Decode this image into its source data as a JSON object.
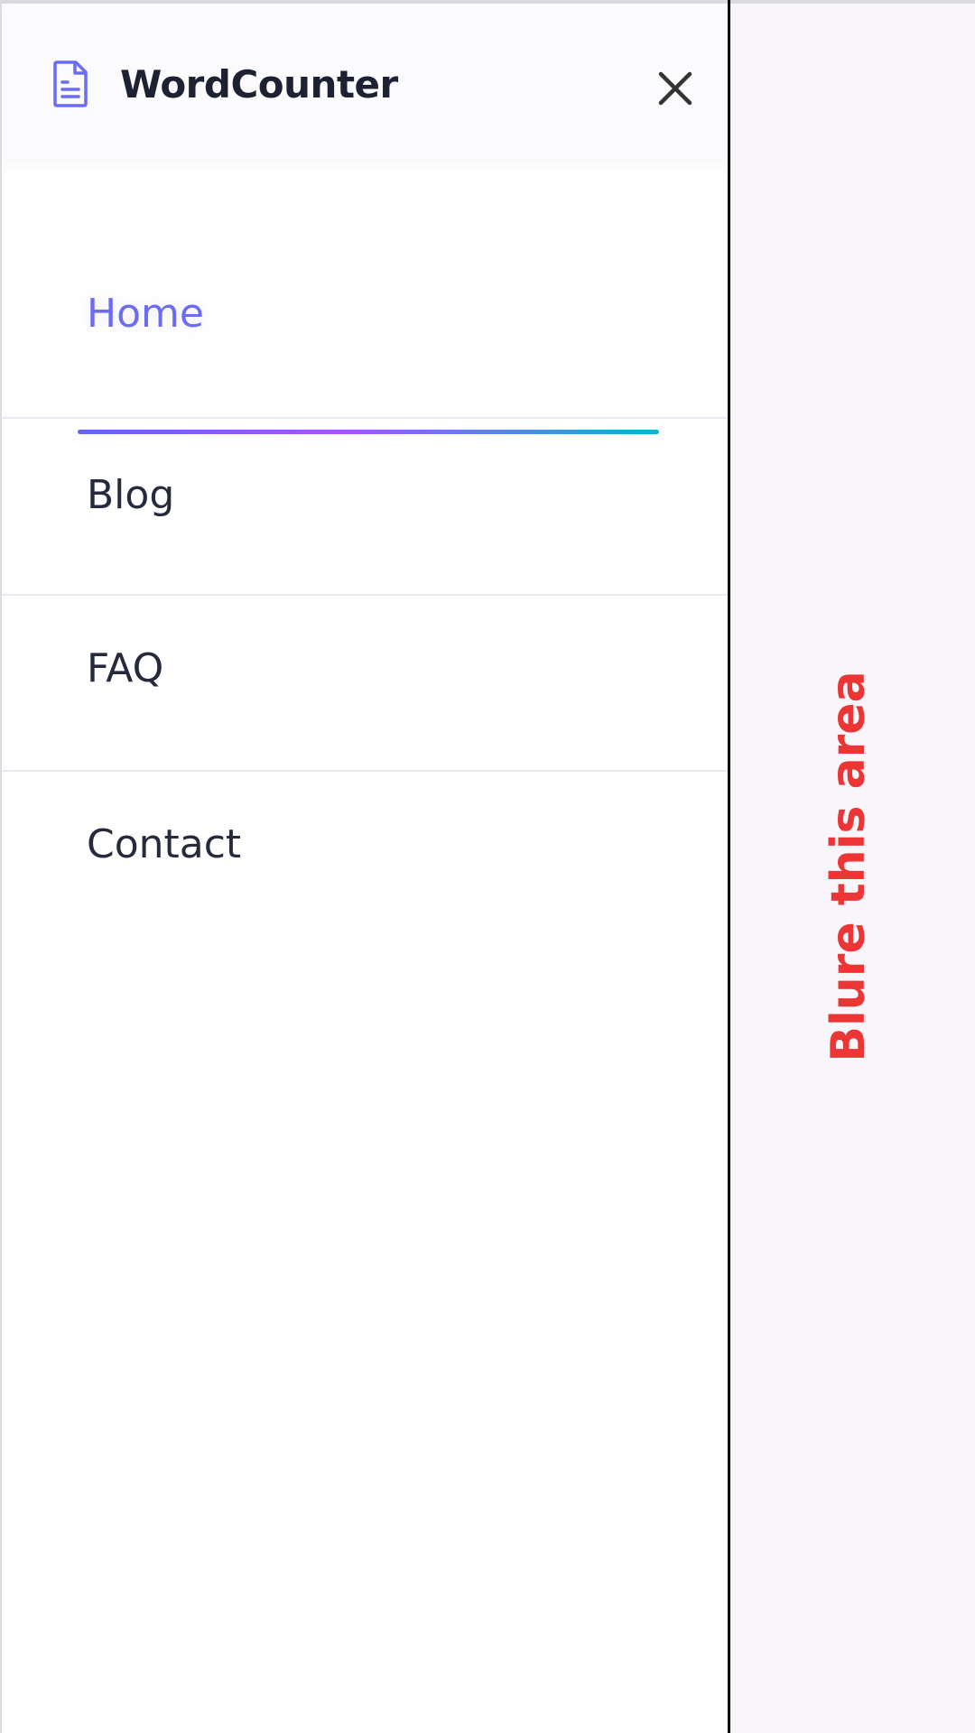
{
  "header": {
    "brand": "WordCounter",
    "logo_icon": "document-icon",
    "close_icon": "close-icon"
  },
  "nav": {
    "items": [
      {
        "label": "Home",
        "active": true
      },
      {
        "label": "Blog",
        "active": false
      },
      {
        "label": "FAQ",
        "active": false
      },
      {
        "label": "Contact",
        "active": false
      }
    ]
  },
  "overlay": {
    "note": "Blure this  area"
  },
  "colors": {
    "accent": "#6c6cf2",
    "text": "#252b3d",
    "note": "#ec3535",
    "underline_gradient": [
      "#6366f1",
      "#a855f7",
      "#06b6d4"
    ]
  }
}
